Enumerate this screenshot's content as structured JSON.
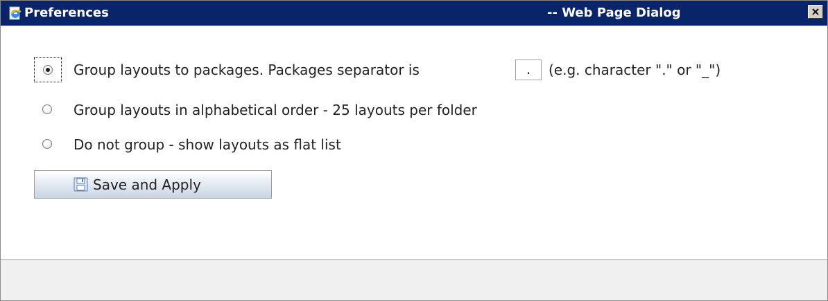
{
  "window": {
    "title": "Preferences",
    "title_suffix": "-- Web Page Dialog",
    "close_label": "×",
    "title_bar_color": "#0a246a"
  },
  "options": [
    {
      "label": "Group layouts to packages. Packages separator is",
      "checked": true,
      "separator_value": ".",
      "hint": "(e.g. character \".\" or \"_\")"
    },
    {
      "label": "Group layouts in alphabetical order - 25 layouts per folder",
      "checked": false
    },
    {
      "label": "Do not group - show layouts as flat list",
      "checked": false
    }
  ],
  "actions": {
    "save_label": "Save and Apply",
    "save_icon": "floppy-disk-icon"
  }
}
